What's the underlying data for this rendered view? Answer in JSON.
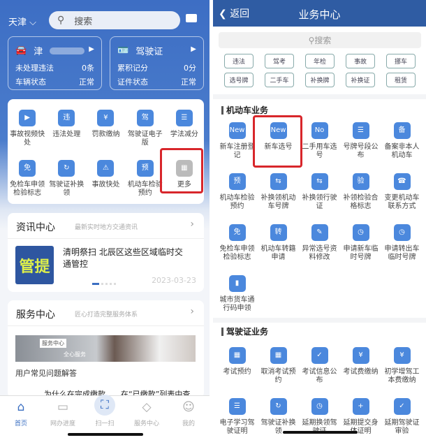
{
  "left": {
    "city": "天津",
    "search_placeholder": "搜索",
    "vehicle_card": {
      "plate": "津",
      "rows": [
        {
          "label": "未处理违法",
          "value": "0条"
        },
        {
          "label": "车辆状态",
          "value": "正常"
        }
      ]
    },
    "license_card": {
      "title": "驾驶证",
      "rows": [
        {
          "label": "累积记分",
          "value": "0分"
        },
        {
          "label": "证件状态",
          "value": "正常"
        }
      ]
    },
    "services": [
      {
        "label": "事故视频快处",
        "icon": "alarm-video-icon",
        "glyph": "▶"
      },
      {
        "label": "违法处理",
        "icon": "violation-icon",
        "glyph": "违"
      },
      {
        "label": "罚款缴纳",
        "icon": "fine-receipt-icon",
        "glyph": "¥"
      },
      {
        "label": "驾驶证电子版",
        "icon": "e-license-icon",
        "glyph": "驾"
      },
      {
        "label": "学法减分",
        "icon": "book-icon",
        "glyph": "☰"
      },
      {
        "label": "免检车申领检验标志",
        "icon": "exempt-icon",
        "glyph": "免"
      },
      {
        "label": "驾驶证补换领",
        "icon": "license-renew-icon",
        "glyph": "↻"
      },
      {
        "label": "事故快处",
        "icon": "car-crash-icon",
        "glyph": "⚠"
      },
      {
        "label": "机动车检验预约",
        "icon": "vehicle-inspect-icon",
        "glyph": "预"
      },
      {
        "label": "更多",
        "icon": "more-grid-icon",
        "glyph": "▦"
      }
    ],
    "news": {
      "title": "资讯中心",
      "subtitle": "最新实时地方交通资讯",
      "thumb_text": "管提",
      "headline": "清明祭扫 北辰区这些区域临时交通管控",
      "date": "2023-03-23",
      "slide_index": 1,
      "slide_count": 5
    },
    "service_center": {
      "title": "服务中心",
      "subtitle": "匠心打造完整服务体系",
      "banner_tag": "服务中心",
      "banner_text": "全心服务",
      "faq": "用户常见问题解答",
      "faq_item": "为什么在完成缴款……在“已缴款”列表中查"
    },
    "tabs": [
      {
        "label": "首页",
        "icon": "home-icon",
        "glyph": "⌂"
      },
      {
        "label": "网办进度",
        "icon": "monitor-icon",
        "glyph": "▭"
      },
      {
        "label": "扫一扫",
        "icon": "scan-icon",
        "glyph": "⛶"
      },
      {
        "label": "服务中心",
        "icon": "service-icon",
        "glyph": "◇"
      },
      {
        "label": "我的",
        "icon": "user-icon",
        "glyph": "☺"
      }
    ]
  },
  "right": {
    "back": "返回",
    "title": "业务中心",
    "search_placeholder": "搜索",
    "chips": [
      "违法",
      "驾考",
      "年检",
      "事故",
      "挪车",
      "选号牌",
      "二手车",
      "补换牌",
      "补换证",
      "租赁"
    ],
    "vehicle_section": {
      "title": "机动车业务",
      "items": [
        {
          "label": "新车注册登记",
          "glyph": "New"
        },
        {
          "label": "新车选号",
          "glyph": "New"
        },
        {
          "label": "二手用车选号",
          "glyph": "No"
        },
        {
          "label": "号牌号段公布",
          "glyph": "☰"
        },
        {
          "label": "备案非本人机动车",
          "glyph": "备"
        },
        {
          "label": "机动车检验预约",
          "glyph": "预"
        },
        {
          "label": "补换领机动车号牌",
          "glyph": "⇆"
        },
        {
          "label": "补换领行驶证",
          "glyph": "⇆"
        },
        {
          "label": "补领检验合格标志",
          "glyph": "验"
        },
        {
          "label": "变更机动车联系方式",
          "glyph": "☎"
        },
        {
          "label": "免检车申领检验标志",
          "glyph": "免"
        },
        {
          "label": "机动车转籍申请",
          "glyph": "转"
        },
        {
          "label": "异常选号资料修改",
          "glyph": "✎"
        },
        {
          "label": "申请新车临时号牌",
          "glyph": "◷"
        },
        {
          "label": "申请转出车临时号牌",
          "glyph": "◷"
        },
        {
          "label": "城市货车通行码申领",
          "glyph": "▮"
        }
      ]
    },
    "license_section": {
      "title": "驾驶证业务",
      "items": [
        {
          "label": "考试预约",
          "glyph": "▦"
        },
        {
          "label": "取消考试预约",
          "glyph": "▦"
        },
        {
          "label": "考试信息公布",
          "glyph": "✓"
        },
        {
          "label": "考试费缴纳",
          "glyph": "¥"
        },
        {
          "label": "初学增驾工本费缴纳",
          "glyph": "¥"
        },
        {
          "label": "电子学习驾驶证明",
          "glyph": "☰"
        },
        {
          "label": "驾驶证补换领",
          "glyph": "↻"
        },
        {
          "label": "延期换领驾驶证",
          "glyph": "◷"
        },
        {
          "label": "延期提交身体证明",
          "glyph": "+"
        },
        {
          "label": "延期驾驶证审验",
          "glyph": "✓"
        }
      ]
    }
  },
  "colors": {
    "brand_blue": "#3d6ec4",
    "header_blue": "#2f5ca3",
    "icon_blue": "#4b88dd",
    "highlight_red": "#d8262b"
  }
}
